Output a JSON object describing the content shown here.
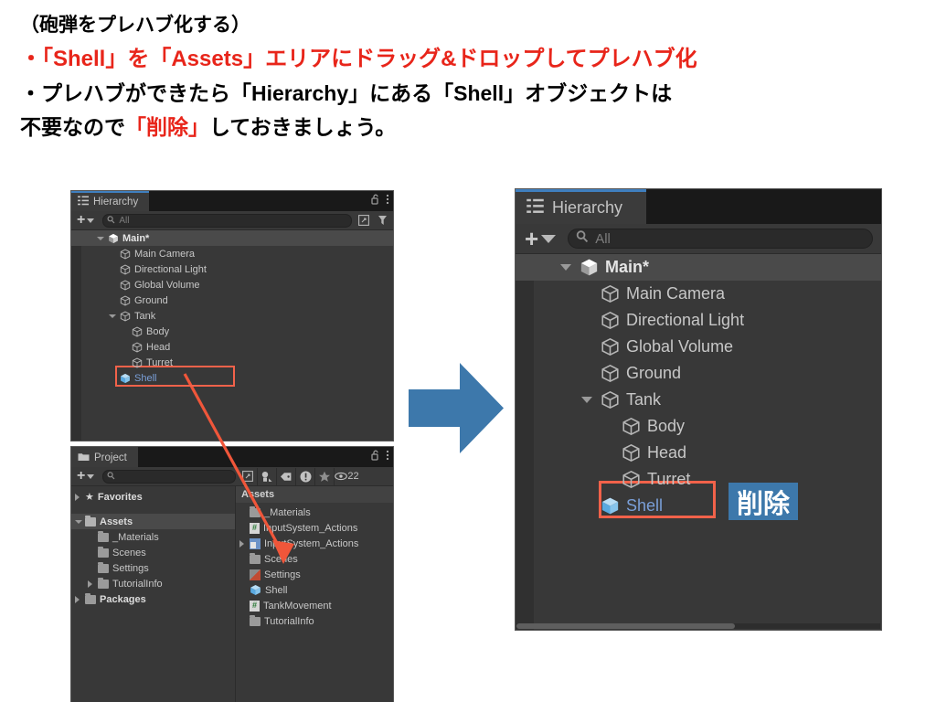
{
  "instructions": {
    "line1": "（砲弾をプレハブ化する）",
    "line2": "・「Shell」を「Assets」エリアにドラッグ&ドロップしてプレハブ化",
    "line3a": "・プレハブができたら「Hierarchy」にある「Shell」オブジェクトは",
    "line4a": "不要なので",
    "line4b": "「削除」",
    "line4c": "しておきましょう。"
  },
  "left_hierarchy": {
    "tab_label": "Hierarchy",
    "tab_icon": "hierarchy-icon",
    "lock_icon": "lock-open-icon",
    "menu_icon": "kebab-menu-icon",
    "add_label": "+",
    "search_placeholder": "All",
    "search_icon": "search-icon",
    "rows": [
      {
        "label": "Main*",
        "indent": 1,
        "icon": "unity-scene-icon",
        "expanded": true,
        "bold": true,
        "selected": true
      },
      {
        "label": "Main Camera",
        "indent": 2,
        "icon": "gameobject-cube-icon",
        "expanded": null,
        "bold": false,
        "selected": false
      },
      {
        "label": "Directional Light",
        "indent": 2,
        "icon": "gameobject-cube-icon",
        "expanded": null,
        "bold": false,
        "selected": false
      },
      {
        "label": "Global Volume",
        "indent": 2,
        "icon": "gameobject-cube-icon",
        "expanded": null,
        "bold": false,
        "selected": false
      },
      {
        "label": "Ground",
        "indent": 2,
        "icon": "gameobject-cube-icon",
        "expanded": null,
        "bold": false,
        "selected": false
      },
      {
        "label": "Tank",
        "indent": 2,
        "icon": "gameobject-cube-icon",
        "expanded": true,
        "bold": false,
        "selected": false
      },
      {
        "label": "Body",
        "indent": 3,
        "icon": "gameobject-cube-icon",
        "expanded": null,
        "bold": false,
        "selected": false
      },
      {
        "label": "Head",
        "indent": 3,
        "icon": "gameobject-cube-icon",
        "expanded": null,
        "bold": false,
        "selected": false
      },
      {
        "label": "Turret",
        "indent": 3,
        "icon": "gameobject-cube-icon",
        "expanded": null,
        "bold": false,
        "selected": false
      },
      {
        "label": "Shell",
        "indent": 2,
        "icon": "prefab-cube-icon",
        "expanded": null,
        "bold": false,
        "selected": false,
        "prefab": true
      }
    ]
  },
  "left_project": {
    "tab_label": "Project",
    "tab_icon": "folder-icon",
    "lock_icon": "lock-open-icon",
    "menu_icon": "kebab-menu-icon",
    "add_label": "+",
    "search_placeholder": "",
    "search_icon": "search-icon",
    "toolbar_icons": [
      "save-filter-icon",
      "label-tag-icon",
      "type-filter-icon",
      "favorite-star-icon",
      "visibility-eye-icon"
    ],
    "visibility_count": "22",
    "tree": [
      {
        "label": "Favorites",
        "indent": 0,
        "icon": "favorite-star-icon",
        "arrow": "right",
        "bold": true
      },
      {
        "label": "",
        "indent": 0,
        "icon": "",
        "arrow": null,
        "bold": false
      },
      {
        "label": "Assets",
        "indent": 0,
        "icon": "folder-open-icon",
        "arrow": "down",
        "bold": true,
        "selected": true
      },
      {
        "label": "_Materials",
        "indent": 1,
        "icon": "folder-icon",
        "arrow": null,
        "bold": false
      },
      {
        "label": "Scenes",
        "indent": 1,
        "icon": "folder-icon",
        "arrow": null,
        "bold": false
      },
      {
        "label": "Settings",
        "indent": 1,
        "icon": "folder-icon",
        "arrow": null,
        "bold": false
      },
      {
        "label": "TutorialInfo",
        "indent": 1,
        "icon": "folder-icon",
        "arrow": "right",
        "bold": false
      },
      {
        "label": "Packages",
        "indent": 0,
        "icon": "folder-icon",
        "arrow": "right",
        "bold": true
      }
    ],
    "assets_header": "Assets",
    "assets": [
      {
        "label": "_Materials",
        "icon": "folder-icon",
        "arrow": null
      },
      {
        "label": "InputSystem_Actions",
        "icon": "script-hash-icon",
        "arrow": null
      },
      {
        "label": "InputSystem_Actions",
        "icon": "input-asset-icon",
        "arrow": "right"
      },
      {
        "label": "Scenes",
        "icon": "folder-icon",
        "arrow": null
      },
      {
        "label": "Settings",
        "icon": "settings-asset-icon",
        "arrow": null
      },
      {
        "label": "Shell",
        "icon": "prefab-cube-icon",
        "arrow": null
      },
      {
        "label": "TankMovement",
        "icon": "script-hash-icon",
        "arrow": null
      },
      {
        "label": "TutorialInfo",
        "icon": "folder-icon",
        "arrow": null
      }
    ]
  },
  "right_hierarchy": {
    "tab_label": "Hierarchy",
    "tab_icon": "hierarchy-icon",
    "add_label": "+",
    "search_placeholder": "All",
    "search_icon": "search-icon",
    "rows": [
      {
        "label": "Main*",
        "indent": 1,
        "icon": "unity-scene-icon",
        "expanded": true,
        "bold": true,
        "selected": true
      },
      {
        "label": "Main Camera",
        "indent": 2,
        "icon": "gameobject-cube-icon",
        "expanded": null,
        "bold": false,
        "selected": false
      },
      {
        "label": "Directional Light",
        "indent": 2,
        "icon": "gameobject-cube-icon",
        "expanded": null,
        "bold": false,
        "selected": false
      },
      {
        "label": "Global Volume",
        "indent": 2,
        "icon": "gameobject-cube-icon",
        "expanded": null,
        "bold": false,
        "selected": false
      },
      {
        "label": "Ground",
        "indent": 2,
        "icon": "gameobject-cube-icon",
        "expanded": null,
        "bold": false,
        "selected": false
      },
      {
        "label": "Tank",
        "indent": 2,
        "icon": "gameobject-cube-icon",
        "expanded": true,
        "bold": false,
        "selected": false
      },
      {
        "label": "Body",
        "indent": 3,
        "icon": "gameobject-cube-icon",
        "expanded": null,
        "bold": false,
        "selected": false
      },
      {
        "label": "Head",
        "indent": 3,
        "icon": "gameobject-cube-icon",
        "expanded": null,
        "bold": false,
        "selected": false
      },
      {
        "label": "Turret",
        "indent": 3,
        "icon": "gameobject-cube-icon",
        "expanded": null,
        "bold": false,
        "selected": false
      },
      {
        "label": "Shell",
        "indent": 2,
        "icon": "prefab-cube-icon",
        "expanded": null,
        "bold": false,
        "selected": false,
        "prefab": true
      }
    ]
  },
  "annotations": {
    "delete_badge_label": "削除",
    "arrow_label": "step-arrow-right",
    "drag_line_label": "drag-drop-arrow",
    "highlight_color": "#f2624a",
    "badge_color": "#3d78ab",
    "accent_red": "#e8251a"
  }
}
